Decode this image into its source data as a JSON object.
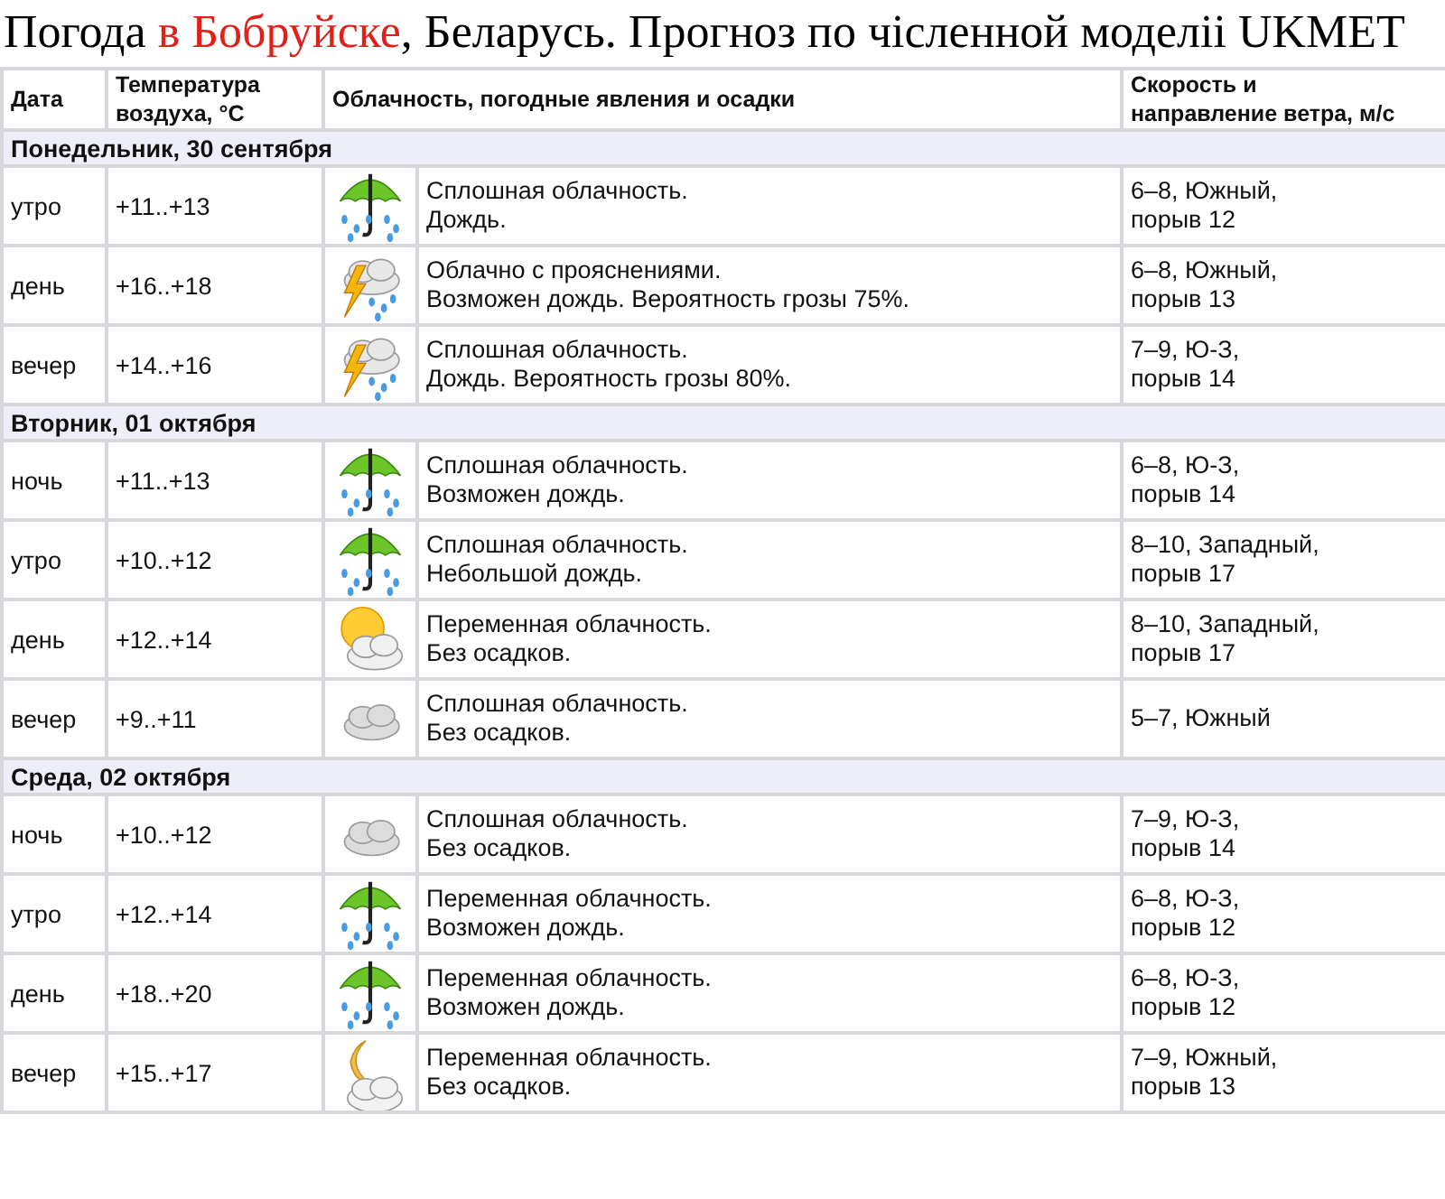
{
  "title": [
    {
      "text": "Погода ",
      "color": "#000000"
    },
    {
      "text": "в Бобруйске",
      "color": "#e0201a"
    },
    {
      "text": ", Беларусь. Прогноз по чіcленной моделіі UKMET",
      "color": "#000000"
    }
  ],
  "columns": [
    [
      "Дата"
    ],
    [
      "Температура",
      "воздуха, °С"
    ],
    [
      "Облачность, погодные явления и осадки"
    ],
    [],
    [
      "Скорость и",
      "направление ветра, м/с"
    ]
  ],
  "days": [
    {
      "date": "Понедельник, 30 сентября",
      "rows": [
        {
          "time": "утро",
          "temp": "+11..+13",
          "kind": "rain",
          "desc": [
            "Сплошная облачность.",
            "Дождь."
          ],
          "wind": [
            "6–8, Южный,",
            "порыв 12"
          ]
        },
        {
          "time": "день",
          "temp": "+16..+18",
          "kind": "storm",
          "desc": [
            "Облачно с прояснениями.",
            "Возможен дождь. Вероятность грозы 75%."
          ],
          "wind": [
            "6–8, Южный,",
            "порыв 13"
          ]
        },
        {
          "time": "вечер",
          "temp": "+14..+16",
          "kind": "storm",
          "desc": [
            "Сплошная облачность.",
            "Дождь. Вероятность грозы 80%."
          ],
          "wind": [
            "7–9, Ю-З,",
            "порыв 14"
          ]
        }
      ]
    },
    {
      "date": "Вторник, 01 октября",
      "rows": [
        {
          "time": "ночь",
          "temp": "+11..+13",
          "kind": "rain",
          "desc": [
            "Сплошная облачность.",
            "Возможен дождь."
          ],
          "wind": [
            "6–8, Ю-З,",
            "порыв 14"
          ]
        },
        {
          "time": "утро",
          "temp": "+10..+12",
          "kind": "rain",
          "desc": [
            "Сплошная облачность.",
            "Небольшой дождь."
          ],
          "wind": [
            "8–10, Западный,",
            "порыв 17"
          ]
        },
        {
          "time": "день",
          "temp": "+12..+14",
          "kind": "sun",
          "desc": [
            "Переменная облачность.",
            "Без осадков."
          ],
          "wind": [
            "8–10, Западный,",
            "порыв 17"
          ]
        },
        {
          "time": "вечер",
          "temp": "+9..+11",
          "kind": "cloud",
          "desc": [
            "Сплошная облачность.",
            "Без осадков."
          ],
          "wind": [
            "5–7, Южный"
          ]
        }
      ]
    },
    {
      "date": "Среда, 02 октября",
      "rows": [
        {
          "time": "ночь",
          "temp": "+10..+12",
          "kind": "cloud",
          "desc": [
            "Сплошная облачность.",
            "Без осадков."
          ],
          "wind": [
            "7–9, Ю-З,",
            "порыв 14"
          ]
        },
        {
          "time": "утро",
          "temp": "+12..+14",
          "kind": "rain",
          "desc": [
            "Переменная облачность.",
            "Возможен дождь."
          ],
          "wind": [
            "6–8, Ю-З,",
            "порыв 12"
          ]
        },
        {
          "time": "день",
          "temp": "+18..+20",
          "kind": "rain",
          "desc": [
            "Переменная облачность.",
            "Возможен дождь."
          ],
          "wind": [
            "6–8, Ю-З,",
            "порыв 12"
          ]
        },
        {
          "time": "вечер",
          "temp": "+15..+17",
          "kind": "moon",
          "desc": [
            "Переменная облачность.",
            "Без осадков."
          ],
          "wind": [
            "7–9, Южный,",
            "порыв 13"
          ]
        }
      ]
    }
  ]
}
